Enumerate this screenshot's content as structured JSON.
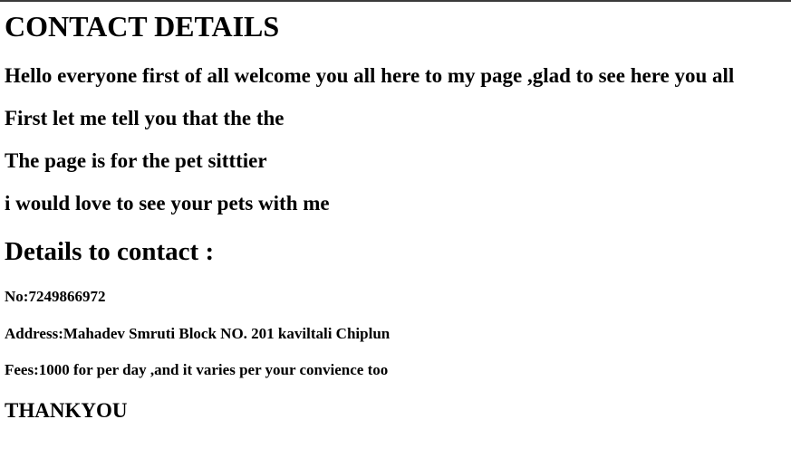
{
  "page": {
    "title": "CONTACT DETAILS",
    "intro_lines": [
      "Hello everyone first of all welcome you all here to my page ,glad to see here you all",
      "First let me tell you that the the",
      "The page is for the pet sitttier",
      "i would love to see your pets with me"
    ],
    "details_heading": "Details to contact :",
    "details": {
      "number": "No:7249866972",
      "address": "Address:Mahadev Smruti Block NO. 201 kaviltali Chiplun",
      "fees": "Fees:1000 for per day ,and it varies per your convience too"
    },
    "closing": "THANKYOU"
  }
}
